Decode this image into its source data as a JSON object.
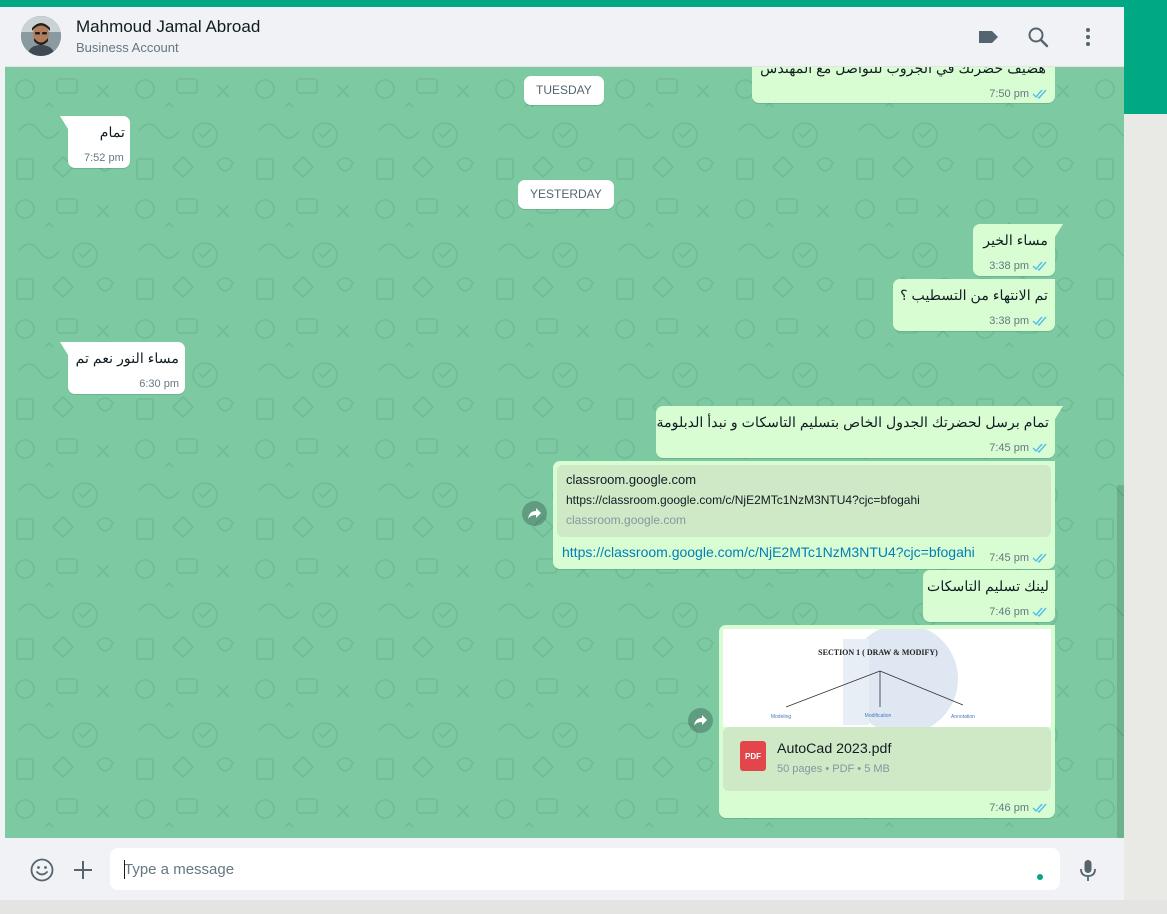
{
  "header": {
    "contact_name": "Mahmoud Jamal Abroad",
    "contact_subtitle": "Business Account",
    "icons": [
      "label-icon",
      "search-icon",
      "menu-icon"
    ]
  },
  "colors": {
    "accent": "#00a884",
    "chat_background": "#7dcaa2",
    "incoming_bubble": "#ffffff",
    "outgoing_bubble": "#d9fdd3",
    "read_ticks": "#53bdeb",
    "link": "#027eb5"
  },
  "messages": {
    "m0_text": "هضيف حضرتك في الجروب للتواصل مع المهندس",
    "m0_time": "7:50 pm",
    "date_tuesday": "TUESDAY",
    "m1_text": "تمام",
    "m1_time": "7:52 pm",
    "date_yesterday": "YESTERDAY",
    "m2_text": "مساء الخير",
    "m2_time": "3:38 pm",
    "m3_text": "تم الانتهاء من التسطيب ؟",
    "m3_time": "3:38 pm",
    "m4_text": "مساء النور نعم تم",
    "m4_time": "6:30 pm",
    "m5_text": "تمام برسل لحضرتك الجدول الخاص بتسليم التاسكات و نبدأ الدبلومة",
    "m5_time": "7:45 pm",
    "m6_preview_title": "classroom.google.com",
    "m6_preview_description": "https://classroom.google.com/c/NjE2MTc1NzM3NTU4?cjc=bfogahi",
    "m6_preview_domain": "classroom.google.com",
    "m6_link": "https://classroom.google.com/c/NjE2MTc1NzM3NTU4?cjc=bfogahi",
    "m6_time": "7:45 pm",
    "m7_text": "لينك تسليم التاسكات",
    "m7_time": "7:46 pm",
    "m8_thumb_heading": "SECTION 1 ( DRAW & MODIFY)",
    "m8_thumb_labels": [
      "Modeling",
      "Modification",
      "Annotation"
    ],
    "m8_doc_name": "AutoCad 2023.pdf",
    "m8_doc_badge": "PDF",
    "m8_doc_meta": "50 pages • PDF • 5 MB",
    "m8_time": "7:46 pm"
  },
  "compose": {
    "placeholder": "Type a message",
    "icons": [
      "emoji-icon",
      "attach-icon",
      "microphone-icon"
    ]
  }
}
